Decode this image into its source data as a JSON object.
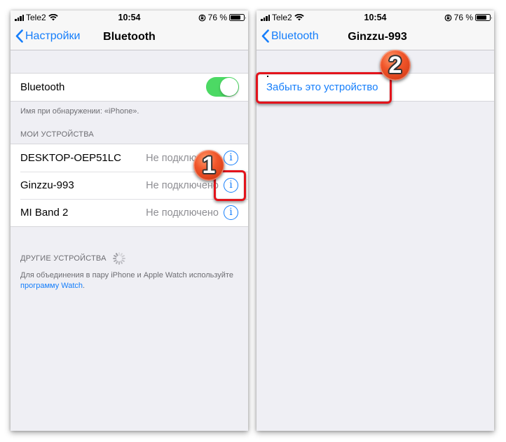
{
  "status_bar": {
    "carrier": "Tele2",
    "time": "10:54",
    "battery_percent_label": "76 %",
    "battery_level": 0.76,
    "icons": [
      "signal-icon",
      "wifi-icon",
      "orientation-lock-icon",
      "battery-icon"
    ]
  },
  "left_screen": {
    "nav": {
      "back_label": "Настройки",
      "title": "Bluetooth"
    },
    "bluetooth_row": {
      "label": "Bluetooth",
      "toggle_on": true
    },
    "discoverable_note": "Имя при обнаружении: «iPhone».",
    "my_devices_header": "МОИ УСТРОЙСТВА",
    "devices": [
      {
        "name": "DESKTOP-OEP51LC",
        "status": "Не подключено"
      },
      {
        "name": "Ginzzu-993",
        "status": "Не подключено"
      },
      {
        "name": "MI Band 2",
        "status": "Не подключено"
      }
    ],
    "other_devices_header": "ДРУГИЕ УСТРОЙСТВА",
    "pairing_note_prefix": "Для объединения в пару iPhone и Apple Watch используйте ",
    "pairing_note_link": "программу Watch",
    "pairing_note_suffix": "."
  },
  "right_screen": {
    "nav": {
      "back_label": "Bluetooth",
      "title": "Ginzzu-993"
    },
    "forget_button": "Забыть это устройство"
  },
  "annotations": {
    "step1": "1",
    "step2": "2",
    "highlight_color": "#e3131b"
  },
  "colors": {
    "accent": "#157efb",
    "toggle_on": "#4cd964",
    "background": "#efeff4",
    "secondary_text": "#8e8e93"
  }
}
